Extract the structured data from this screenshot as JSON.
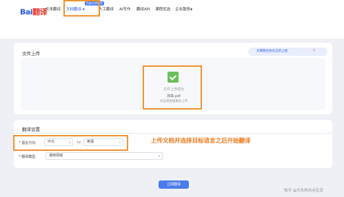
{
  "nav": {
    "logo_part1": "Bai",
    "logo_part2": "翻译",
    "items": [
      {
        "label": "文本翻译"
      },
      {
        "label": "文档翻译"
      },
      {
        "label": "人工翻译"
      },
      {
        "label": "AI写作"
      },
      {
        "label": "翻译API"
      },
      {
        "label": "课程优选"
      },
      {
        "label": "企业服务"
      }
    ],
    "doc_badge": "百度文库联名"
  },
  "upload": {
    "title": "文件上传",
    "pill_text": "文库联合会员全新上线",
    "help": "?",
    "status": "文件上传成功",
    "file_name": "简章.pdf",
    "reupload": "点击或拖拽重新上传"
  },
  "settings": {
    "title": "翻译设置",
    "lang_label": "* 语言方向:",
    "source_lang": "中文",
    "to": "to",
    "target_lang": "英语",
    "model_label": "* 翻译模型:",
    "model_value": "通用领域"
  },
  "annotation": "上传文档并选择目标语言之后开始翻译",
  "submit_label": "立即翻译",
  "watermark": "知乎 @大头的点点生活",
  "colors": {
    "accent": "#4b7bec",
    "highlight": "#f0922e",
    "annotation": "#f07a1c"
  }
}
